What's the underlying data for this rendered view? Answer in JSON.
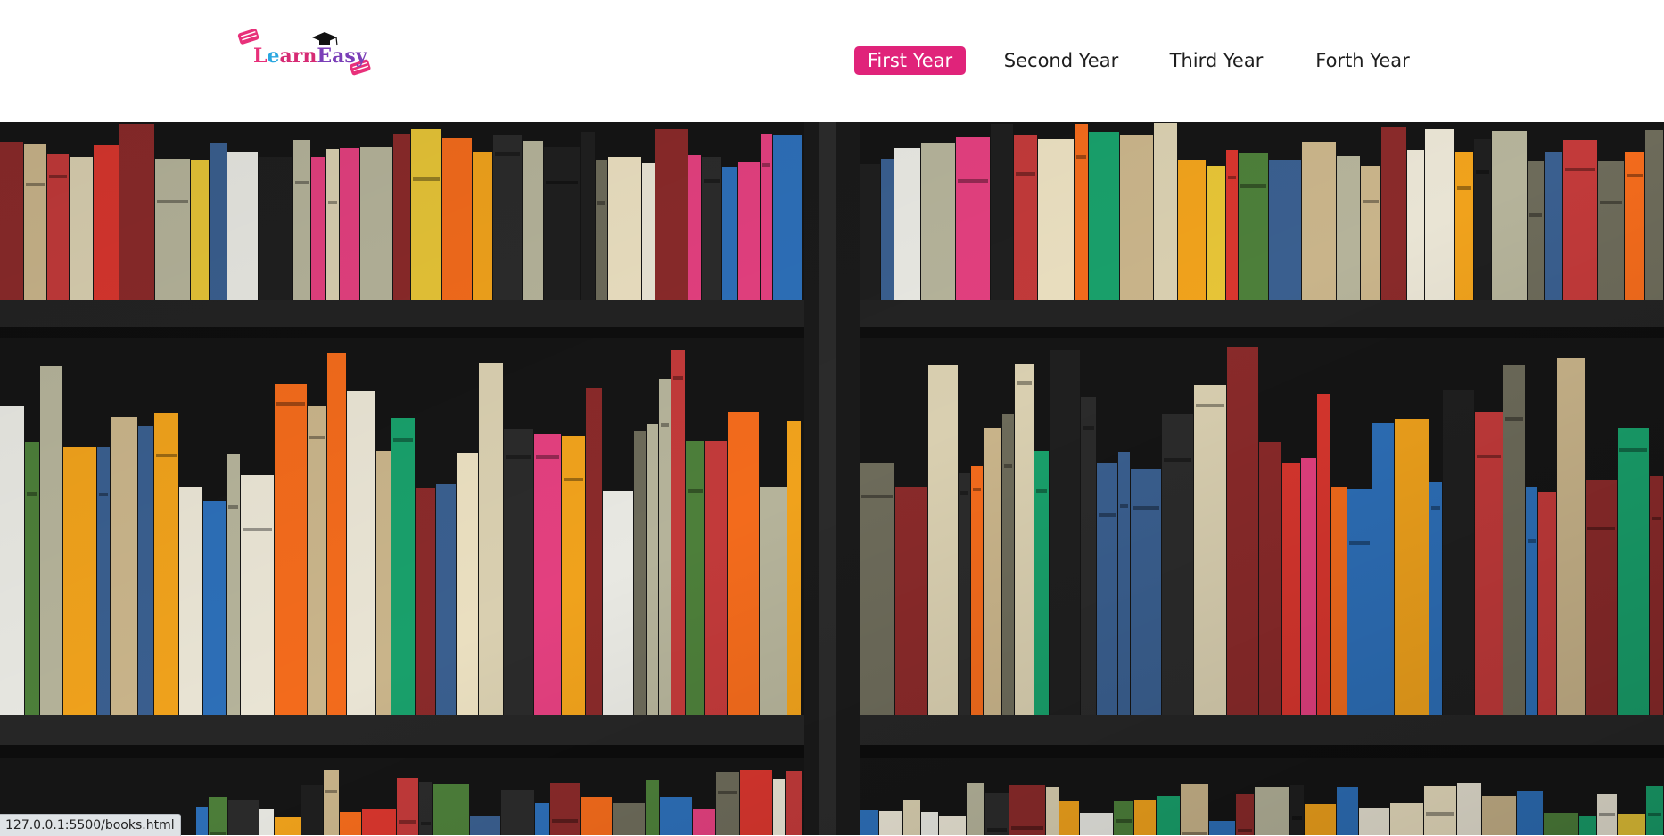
{
  "logo": {
    "name": "LearnEasy",
    "parts": [
      "L",
      "e",
      "arn",
      "Easy"
    ]
  },
  "nav": {
    "items": [
      {
        "label": "First Year",
        "active": true
      },
      {
        "label": "Second Year",
        "active": false
      },
      {
        "label": "Third Year",
        "active": false
      },
      {
        "label": "Forth Year",
        "active": false
      }
    ]
  },
  "hero": {
    "image": "bookshelf-photo",
    "shelf_color": "#1c1c1c",
    "background_color": "#141414"
  },
  "colors": {
    "accent": "#e0237a",
    "text": "#1e1e1e"
  },
  "statusbar": {
    "url": "127.0.0.1:5500/books.html"
  }
}
